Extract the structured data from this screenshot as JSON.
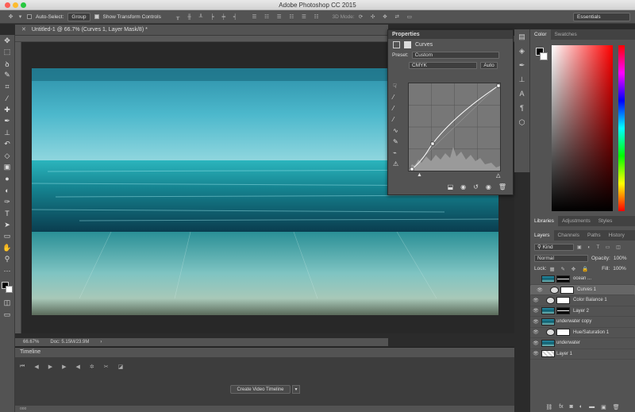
{
  "app": {
    "title": "Adobe Photoshop CC 2015"
  },
  "options": {
    "auto_select_label": "Auto-Select:",
    "group_value": "Group",
    "transform_label": "Show Transform Controls",
    "mode3d": "3D Mode:",
    "workspace": "Essentials"
  },
  "document": {
    "tab_title": "Untitled-1 @ 66.7% (Curves 1, Layer Mask/8) *",
    "zoom": "66.67%",
    "doc_info": "Doc: 5.15M/23.9M"
  },
  "properties": {
    "tab": "Properties",
    "subtitle": "Curves",
    "preset_label": "Preset:",
    "preset_value": "Custom",
    "channel": "CMYK",
    "auto_label": "Auto"
  },
  "timeline": {
    "tab": "Timeline",
    "create_button": "Create Video Timeline"
  },
  "color_panel": {
    "tabs": [
      "Color",
      "Swatches"
    ]
  },
  "lib_tabs": [
    "Libraries",
    "Adjustments",
    "Styles"
  ],
  "layer_tabs": [
    "Layers",
    "Channels",
    "Paths",
    "History"
  ],
  "layers_panel": {
    "kind": "Kind",
    "blend": "Normal",
    "opacity_label": "Opacity:",
    "opacity": "100%",
    "lock_label": "Lock:",
    "fill_label": "Fill:",
    "fill": "100%"
  },
  "layers": [
    {
      "name": "ocean ...",
      "type": "masked",
      "visible": false
    },
    {
      "name": "Curves 1",
      "type": "adj",
      "visible": true,
      "selected": true
    },
    {
      "name": "Color Balance 1",
      "type": "adj",
      "visible": true
    },
    {
      "name": "Layer 2",
      "type": "masked",
      "visible": true
    },
    {
      "name": "underwater copy",
      "type": "image",
      "visible": true
    },
    {
      "name": "Hue/Saturation 1",
      "type": "adj",
      "visible": true
    },
    {
      "name": "underwater",
      "type": "image",
      "visible": true
    },
    {
      "name": "Layer 1",
      "type": "blank",
      "visible": true
    }
  ],
  "colors": {
    "accent": "#4aa9c9",
    "panel": "#535353"
  }
}
